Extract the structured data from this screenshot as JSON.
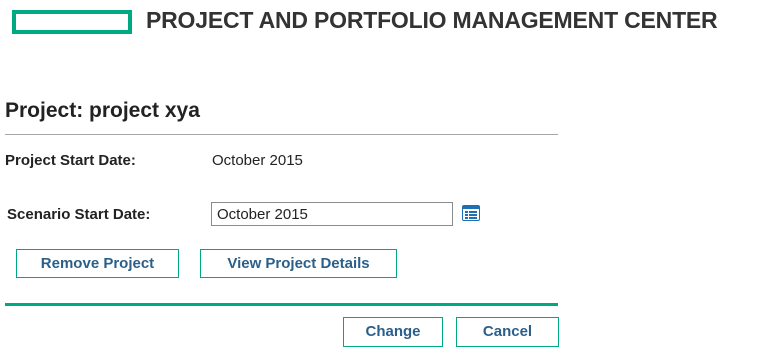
{
  "header": {
    "app_title": "PROJECT AND PORTFOLIO MANAGEMENT CENTER",
    "logo_icon": "hpe-logo-rectangle",
    "brand_color": "#00a982"
  },
  "page": {
    "title": "Project: project xya"
  },
  "form": {
    "project_start_label": "Project Start Date:",
    "project_start_value": "October 2015",
    "scenario_start_label": "Scenario Start Date:",
    "scenario_start_value": "October 2015",
    "calendar_icon": "calendar-icon"
  },
  "actions": {
    "remove_project": "Remove Project",
    "view_project_details": "View Project Details",
    "change": "Change",
    "cancel": "Cancel"
  },
  "colors": {
    "accent": "#00a982",
    "button_text": "#2b5f8a",
    "text": "#222222"
  }
}
